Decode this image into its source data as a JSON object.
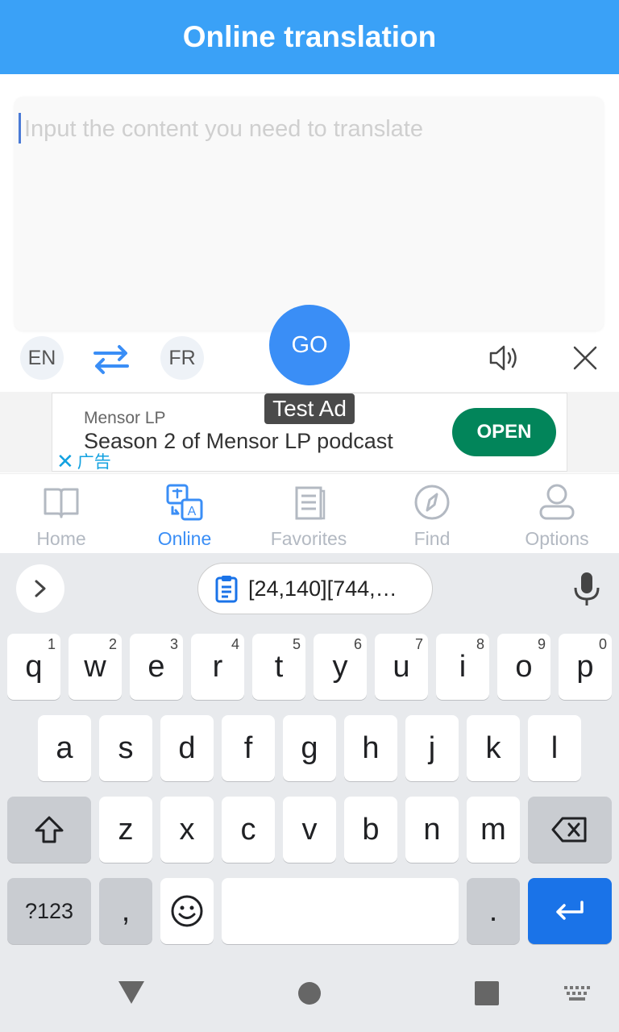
{
  "header": {
    "title": "Online translation"
  },
  "input": {
    "placeholder": "Input the content you need to translate",
    "value": ""
  },
  "controls": {
    "source_lang": "EN",
    "target_lang": "FR",
    "go_label": "GO"
  },
  "ad": {
    "label": "Test Ad",
    "advertiser": "Mensor LP",
    "headline": "Season 2 of Mensor LP podcast",
    "cta": "OPEN",
    "close_text": "广告"
  },
  "nav": {
    "items": [
      {
        "label": "Home",
        "icon": "book-icon",
        "active": false
      },
      {
        "label": "Online",
        "icon": "translate-icon",
        "active": true
      },
      {
        "label": "Favorites",
        "icon": "document-icon",
        "active": false
      },
      {
        "label": "Find",
        "icon": "compass-icon",
        "active": false
      },
      {
        "label": "Options",
        "icon": "user-icon",
        "active": false
      }
    ]
  },
  "keyboard": {
    "clipboard_text": "[24,140][744,…",
    "row1": [
      {
        "char": "q",
        "hint": "1"
      },
      {
        "char": "w",
        "hint": "2"
      },
      {
        "char": "e",
        "hint": "3"
      },
      {
        "char": "r",
        "hint": "4"
      },
      {
        "char": "t",
        "hint": "5"
      },
      {
        "char": "y",
        "hint": "6"
      },
      {
        "char": "u",
        "hint": "7"
      },
      {
        "char": "i",
        "hint": "8"
      },
      {
        "char": "o",
        "hint": "9"
      },
      {
        "char": "p",
        "hint": "0"
      }
    ],
    "row2": [
      "a",
      "s",
      "d",
      "f",
      "g",
      "h",
      "j",
      "k",
      "l"
    ],
    "row3": [
      "z",
      "x",
      "c",
      "v",
      "b",
      "n",
      "m"
    ],
    "symbols_label": "?123",
    "comma": ",",
    "period": "."
  },
  "colors": {
    "header": "#3aa1f7",
    "accent": "#3a8ef6",
    "ad_cta": "#02855a",
    "enter_key": "#1a73e8"
  }
}
